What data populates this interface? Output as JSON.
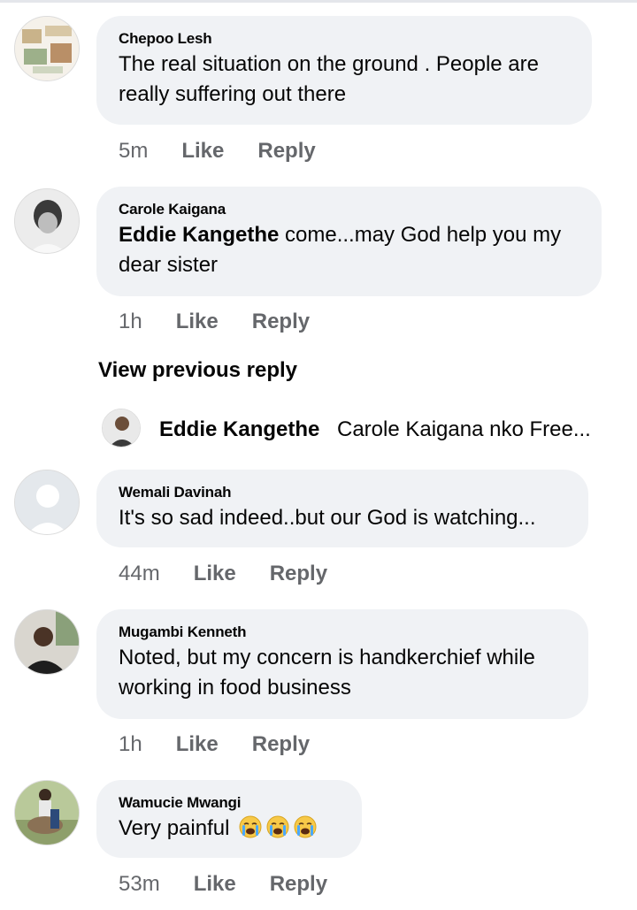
{
  "comments": [
    {
      "author": "Chepoo Lesh",
      "text": "The real situation on the ground .  People are really suffering out there",
      "time": "5m",
      "like": "Like",
      "reply": "Reply"
    },
    {
      "author": "Carole Kaigana",
      "mention": "Eddie Kangethe",
      "text": " come...may God help you my dear sister",
      "time": "1h",
      "like": "Like",
      "reply": "Reply"
    },
    {
      "author": "Wemali Davinah",
      "text": "It's so sad indeed..but our God is watching...",
      "time": "44m",
      "like": "Like",
      "reply": "Reply"
    },
    {
      "author": "Mugambi Kenneth",
      "text": "Noted, but my concern is handkerchief while working in food business",
      "time": "1h",
      "like": "Like",
      "reply": "Reply"
    },
    {
      "author": "Wamucie Mwangi",
      "text": "Very painful ",
      "emojis": [
        "crying-face",
        "crying-face",
        "crying-face"
      ],
      "time": "53m",
      "like": "Like",
      "reply": "Reply"
    }
  ],
  "view_previous_reply": "View previous reply",
  "reply_preview": {
    "author": "Eddie Kangethe",
    "text": "Carole Kaigana nko Free..."
  }
}
